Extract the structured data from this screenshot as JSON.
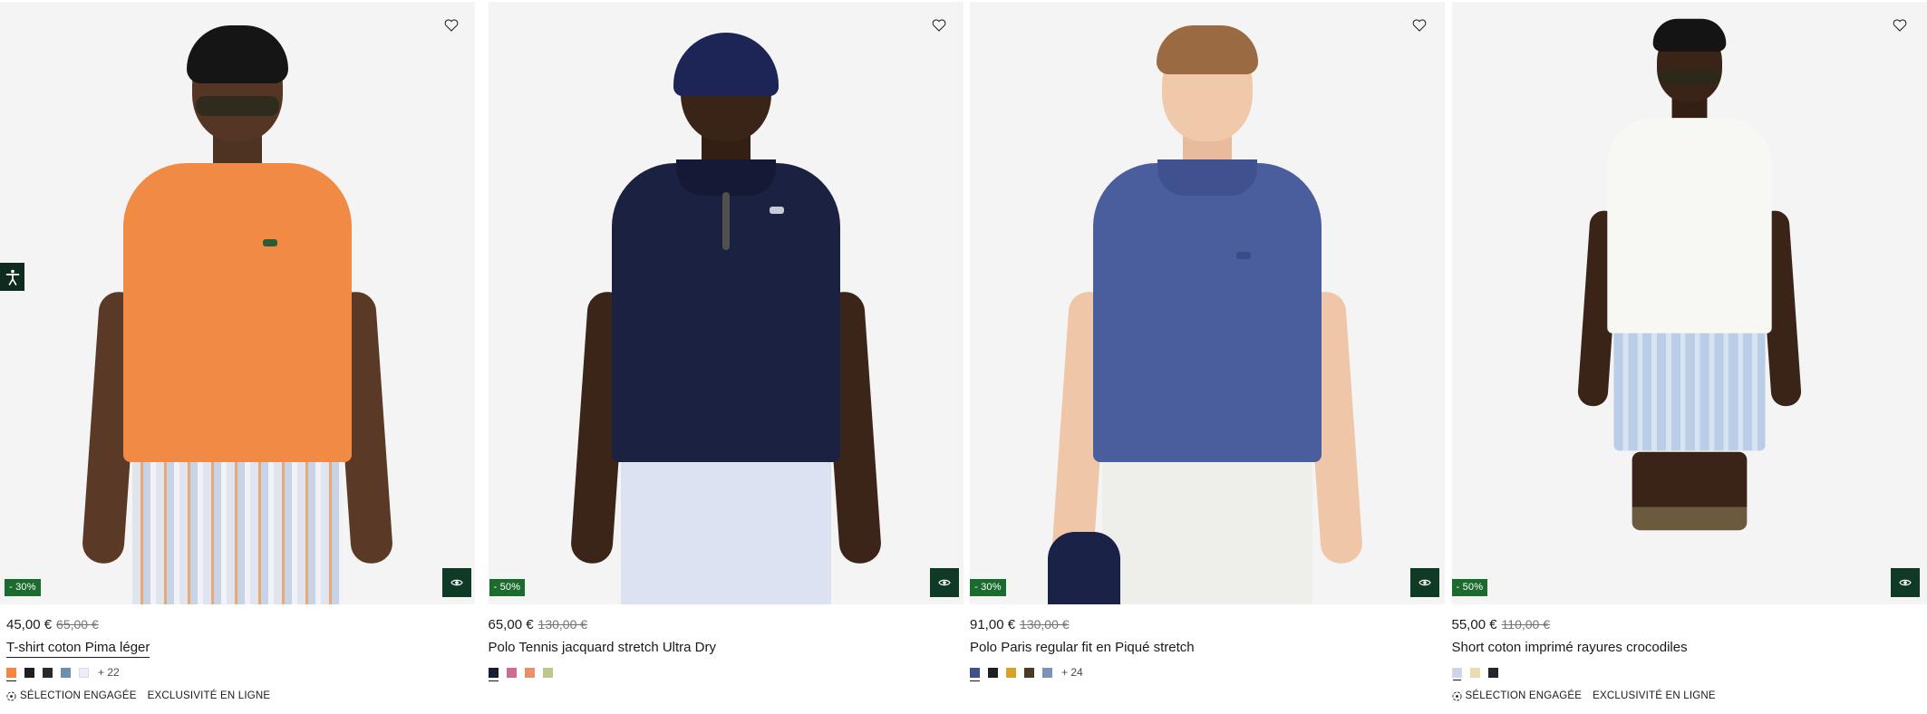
{
  "colors": {
    "background": "#ffffff",
    "media_bg": "#f5f4f4",
    "discount_badge": "#1c6b2e",
    "quick_view": "#0f3a26",
    "text": "#1a1a1a",
    "old_price": "#757575"
  },
  "accessibility": {
    "icon": "accessibility-icon"
  },
  "products": [
    {
      "discount": "- 30%",
      "price_now": "45,00 €",
      "price_old": "65,00 €",
      "title": "T-shirt coton Pima léger",
      "swatches": [
        "#f2873d",
        "#1f1f1f",
        "#262a2e",
        "#6f8fb0",
        "#eceefa"
      ],
      "more_colors": "+ 22",
      "tags": [
        "SÉLECTION ENGAGÉE",
        "EXCLUSIVITÉ EN LIGNE"
      ],
      "favorite_icon": "heart-icon",
      "quick_view_icon": "eye-icon"
    },
    {
      "discount": "- 50%",
      "price_now": "65,00 €",
      "price_old": "130,00 €",
      "title": "Polo Tennis jacquard stretch Ultra Dry",
      "swatches": [
        "#1a1d2e",
        "#d06a93",
        "#e8906a",
        "#b8c98a"
      ],
      "more_colors": "",
      "tags": [],
      "favorite_icon": "heart-icon",
      "quick_view_icon": "eye-icon"
    },
    {
      "discount": "- 30%",
      "price_now": "91,00 €",
      "price_old": "130,00 €",
      "title": "Polo Paris regular fit en Piqué stretch",
      "swatches": [
        "#3f4f8a",
        "#1f1f22",
        "#d8a227",
        "#4a3a26",
        "#7d93b5"
      ],
      "more_colors": "+ 24",
      "tags": [],
      "favorite_icon": "heart-icon",
      "quick_view_icon": "eye-icon"
    },
    {
      "discount": "- 50%",
      "price_now": "55,00 €",
      "price_old": "110,00 €",
      "title": "Short coton imprimé rayures crocodiles",
      "swatches": [
        "#c9d6e8",
        "#e8dcb0",
        "#23272a"
      ],
      "more_colors": "",
      "tags": [
        "SÉLECTION ENGAGÉE",
        "EXCLUSIVITÉ EN LIGNE"
      ],
      "favorite_icon": "heart-icon",
      "quick_view_icon": "eye-icon"
    }
  ]
}
